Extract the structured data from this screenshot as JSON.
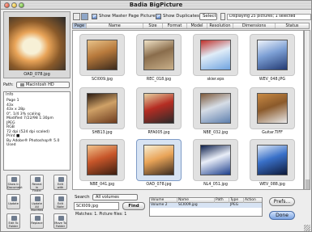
{
  "window": {
    "title": "Badia BigPicture"
  },
  "preview": {
    "caption": "OAD_078.jpg"
  },
  "path": {
    "label": "Path:",
    "value": "Macintosh HD"
  },
  "info": {
    "heading": "Info",
    "lines": [
      "Page 1",
      "43x",
      "43x x 28p",
      "0\", 1/4 3% scaling",
      "Modified 7/22/98 1:30pm",
      "JPEG",
      "RGB",
      "72 dpi (524 dpi scaled)",
      "Print ■",
      "By Adobe® Photoshop® 5.0",
      "Used"
    ]
  },
  "actions": [
    {
      "label": "Show in Document",
      "icon": "show-document-icon"
    },
    {
      "label": "Reveal in Finder",
      "icon": "reveal-finder-icon"
    },
    {
      "label": "Edit with",
      "icon": "edit-with-icon"
    },
    {
      "label": "Update",
      "icon": "update-icon"
    },
    {
      "label": "Update All Modified",
      "icon": "update-all-icon"
    },
    {
      "label": "Edit Note",
      "icon": "edit-note-icon"
    },
    {
      "label": "Edit To Folder",
      "icon": "to-folder-icon"
    },
    {
      "label": "Replace",
      "icon": "replace-icon"
    },
    {
      "label": "Move To Folder",
      "icon": "move-folder-icon"
    }
  ],
  "toolbar": {
    "show_master": "Show Master Page Pictures",
    "show_duplicates": "Show Duplicates",
    "select": "Select",
    "status": "Displaying 25 pictures; 1 selected"
  },
  "columns": [
    "Page",
    "Name",
    "Size",
    "Format",
    "Model",
    "Resolution",
    "Dimensions",
    "Status"
  ],
  "thumbnails": [
    {
      "caption": "SCI009.jpg",
      "colors": [
        "#3b2a1c",
        "#b87a3c",
        "#e8c38a"
      ]
    },
    {
      "caption": "REC_018.jpg",
      "colors": [
        "#c9b08a",
        "#8a6d4c",
        "#f0e2c6"
      ]
    },
    {
      "caption": "skier.eps",
      "colors": [
        "#6fa3df",
        "#e0edf8",
        "#c0302a"
      ]
    },
    {
      "caption": "WEV_048.JPG",
      "colors": [
        "#233a73",
        "#7da0d5",
        "#eef3fb"
      ]
    },
    {
      "caption": "SHB13.jpg",
      "colors": [
        "#6d3b1e",
        "#cfa167",
        "#2a1a10"
      ]
    },
    {
      "caption": "RFA005.jpg",
      "colors": [
        "#2a2a2a",
        "#b52d23",
        "#e6d2a2"
      ]
    },
    {
      "caption": "NBE_032.jpg",
      "colors": [
        "#5d7fae",
        "#d6dde6",
        "#7e5a3b"
      ]
    },
    {
      "caption": "Guitar.TIFF",
      "colors": [
        "#eaeaea",
        "#8b5a2b",
        "#c98a44"
      ]
    },
    {
      "caption": "NBE_041.jpg",
      "colors": [
        "#3c1e10",
        "#c7562a",
        "#f1c48d"
      ]
    },
    {
      "caption": "OAD_078.jpg",
      "colors": [
        "#3a2a1f",
        "#e9a458",
        "#f7f0d6"
      ]
    },
    {
      "caption": "NL4_051.jpg",
      "colors": [
        "#1d3f8c",
        "#e9eef8",
        "#0c1e4a"
      ]
    },
    {
      "caption": "WEV_088.jpg",
      "colors": [
        "#0e1a3a",
        "#3a71c9",
        "#dfe9f7"
      ]
    }
  ],
  "search": {
    "label": "Search",
    "scope": "All volumes",
    "query": "SCI009.jpg",
    "find": "Find",
    "matches": "Matches: 1. Picture files: 1"
  },
  "results": {
    "headers": [
      "Volume",
      "Name",
      "Path",
      "Type",
      "Action"
    ],
    "row": [
      "Volume 2",
      "SCI009.jpg",
      "",
      "JPEG",
      ""
    ]
  },
  "buttons": {
    "prefs": "Prefs...",
    "done": "Done"
  }
}
